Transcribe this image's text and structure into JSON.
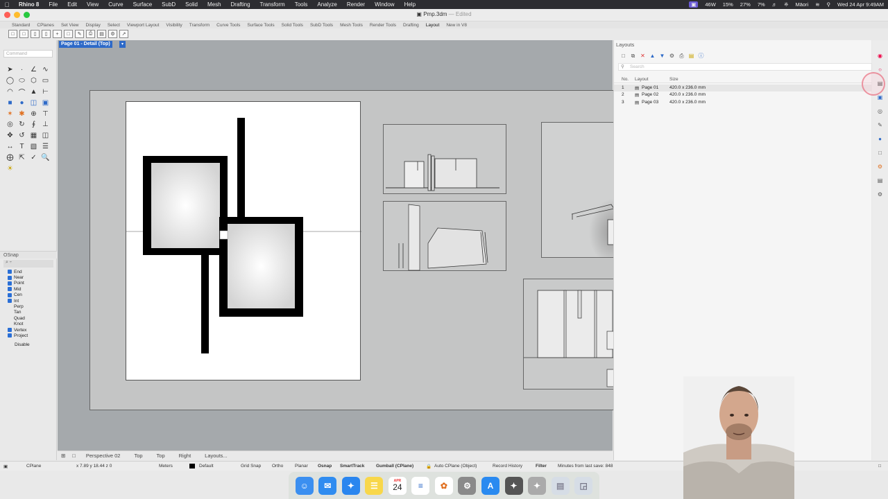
{
  "menubar": {
    "app": "Rhino 8",
    "items": [
      "File",
      "Edit",
      "View",
      "Curve",
      "Surface",
      "SubD",
      "Solid",
      "Mesh",
      "Drafting",
      "Transform",
      "Tools",
      "Analyze",
      "Render",
      "Window",
      "Help"
    ],
    "status": [
      "46W",
      "15%",
      "27%",
      "7%",
      "Wed 24 Apr 9:49AM"
    ],
    "user": "Māori"
  },
  "window": {
    "title": "Pmp.3dm",
    "edited": "— Edited"
  },
  "tabs": [
    "Standard",
    "CPlanes",
    "Set View",
    "Display",
    "Select",
    "Viewport Layout",
    "Visibility",
    "Transform",
    "Curve Tools",
    "Surface Tools",
    "Solid Tools",
    "SubD Tools",
    "Mesh Tools",
    "Render Tools",
    "Drafting",
    "Layout",
    "New in V8"
  ],
  "active_tab": "Layout",
  "command": {
    "placeholder": "Command"
  },
  "viewport": {
    "title": "Page 01 - Detail (Top)"
  },
  "osnap": {
    "title": "OSnap",
    "items": [
      {
        "label": "End",
        "checked": true
      },
      {
        "label": "Near",
        "checked": true
      },
      {
        "label": "Point",
        "checked": true
      },
      {
        "label": "Mid",
        "checked": true
      },
      {
        "label": "Cen",
        "checked": true
      },
      {
        "label": "Int",
        "checked": true
      },
      {
        "label": "Perp",
        "checked": false
      },
      {
        "label": "Tan",
        "checked": false
      },
      {
        "label": "Quad",
        "checked": false
      },
      {
        "label": "Knot",
        "checked": false
      },
      {
        "label": "Vertex",
        "checked": true
      },
      {
        "label": "Project",
        "checked": true
      }
    ],
    "disable": "Disable"
  },
  "view_tabs": [
    "Perspective 02",
    "Top",
    "Top",
    "Right",
    "Layouts..."
  ],
  "statusbar": {
    "cplane": "CPlane",
    "coords": "x 7.89  y 18.44  z 0",
    "units": "Meters",
    "layer": "Default",
    "grid_snap": "Grid Snap",
    "ortho": "Ortho",
    "planar": "Planar",
    "osnap": "Osnap",
    "smarttrack": "SmartTrack",
    "gumball": "Gumball (CPlane)",
    "auto_cplane": "Auto CPlane (Object)",
    "record_history": "Record History",
    "filter": "Filter",
    "last_save": "Minutes from last save: 848"
  },
  "layouts_panel": {
    "title": "Layouts",
    "search_placeholder": "Search",
    "headers": {
      "no": "No.",
      "layout": "Layout",
      "size": "Size"
    },
    "rows": [
      {
        "no": "1",
        "name": "Page 01",
        "size": "420.0 x 236.0 mm",
        "selected": true
      },
      {
        "no": "2",
        "name": "Page 02",
        "size": "420.0 x 236.0 mm",
        "selected": false
      },
      {
        "no": "3",
        "name": "Page 03",
        "size": "420.0 x 236.0 mm",
        "selected": false
      }
    ]
  },
  "dock": {
    "calendar_month": "APR",
    "calendar_day": "24",
    "apps": [
      "finder-icon",
      "mail-icon",
      "safari-icon",
      "notes-icon",
      "calendar-icon",
      "reminders-icon",
      "photos-icon",
      "settings-icon",
      "appstore-icon",
      "rhino-icon",
      "rhino-wip-icon",
      "folder-icon",
      "trash-icon"
    ]
  },
  "colors": {
    "viewport_bg": "#a5a9ac",
    "accent": "#2e6ac8",
    "menubar_bg": "#2d2d31"
  }
}
